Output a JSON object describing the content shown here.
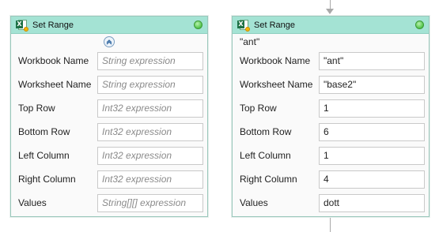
{
  "left_activity": {
    "title": "Set Range",
    "fields": [
      {
        "label": "Workbook Name",
        "value": "",
        "placeholder": "String expression"
      },
      {
        "label": "Worksheet Name",
        "value": "",
        "placeholder": "String expression"
      },
      {
        "label": "Top Row",
        "value": "",
        "placeholder": "Int32 expression"
      },
      {
        "label": "Bottom Row",
        "value": "",
        "placeholder": "Int32 expression"
      },
      {
        "label": "Left Column",
        "value": "",
        "placeholder": "Int32 expression"
      },
      {
        "label": "Right Column",
        "value": "",
        "placeholder": "Int32 expression"
      },
      {
        "label": "Values",
        "value": "",
        "placeholder": "String[][] expression"
      }
    ]
  },
  "right_activity": {
    "title": "Set Range",
    "display_name": "\"ant\"",
    "fields": [
      {
        "label": "Workbook Name",
        "value": "\"ant\"",
        "placeholder": ""
      },
      {
        "label": "Worksheet Name",
        "value": "\"base2\"",
        "placeholder": ""
      },
      {
        "label": "Top Row",
        "value": "1",
        "placeholder": ""
      },
      {
        "label": "Bottom Row",
        "value": "6",
        "placeholder": ""
      },
      {
        "label": "Left Column",
        "value": "1",
        "placeholder": ""
      },
      {
        "label": "Right Column",
        "value": "4",
        "placeholder": ""
      },
      {
        "label": "Values",
        "value": "dott",
        "placeholder": ""
      }
    ]
  },
  "colors": {
    "header_bg": "#a4e3d4",
    "status_ok": "#52c44a",
    "card_border": "#9ac7bb"
  },
  "icons": {
    "activity": "excel-icon",
    "status": "status-ok-icon",
    "collapse": "collapse-icon"
  }
}
